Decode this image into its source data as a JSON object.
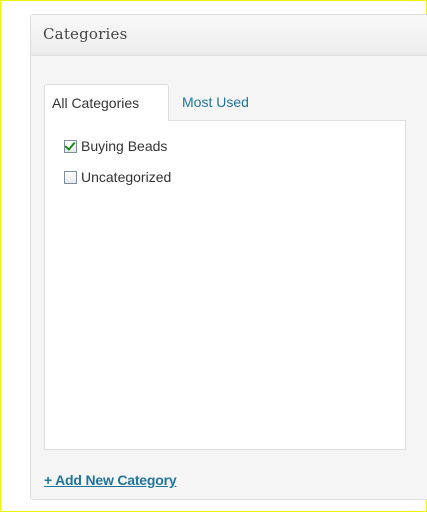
{
  "metabox": {
    "title": "Categories"
  },
  "tabs": [
    {
      "label": "All Categories",
      "active": true
    },
    {
      "label": "Most Used",
      "active": false
    }
  ],
  "categories": [
    {
      "label": "Buying Beads",
      "checked": true
    },
    {
      "label": "Uncategorized",
      "checked": false
    }
  ],
  "add_new": {
    "label": "+ Add New Category"
  },
  "colors": {
    "link": "#21759b",
    "frame_border": "#f2f200",
    "check": "#1a8a1a"
  }
}
